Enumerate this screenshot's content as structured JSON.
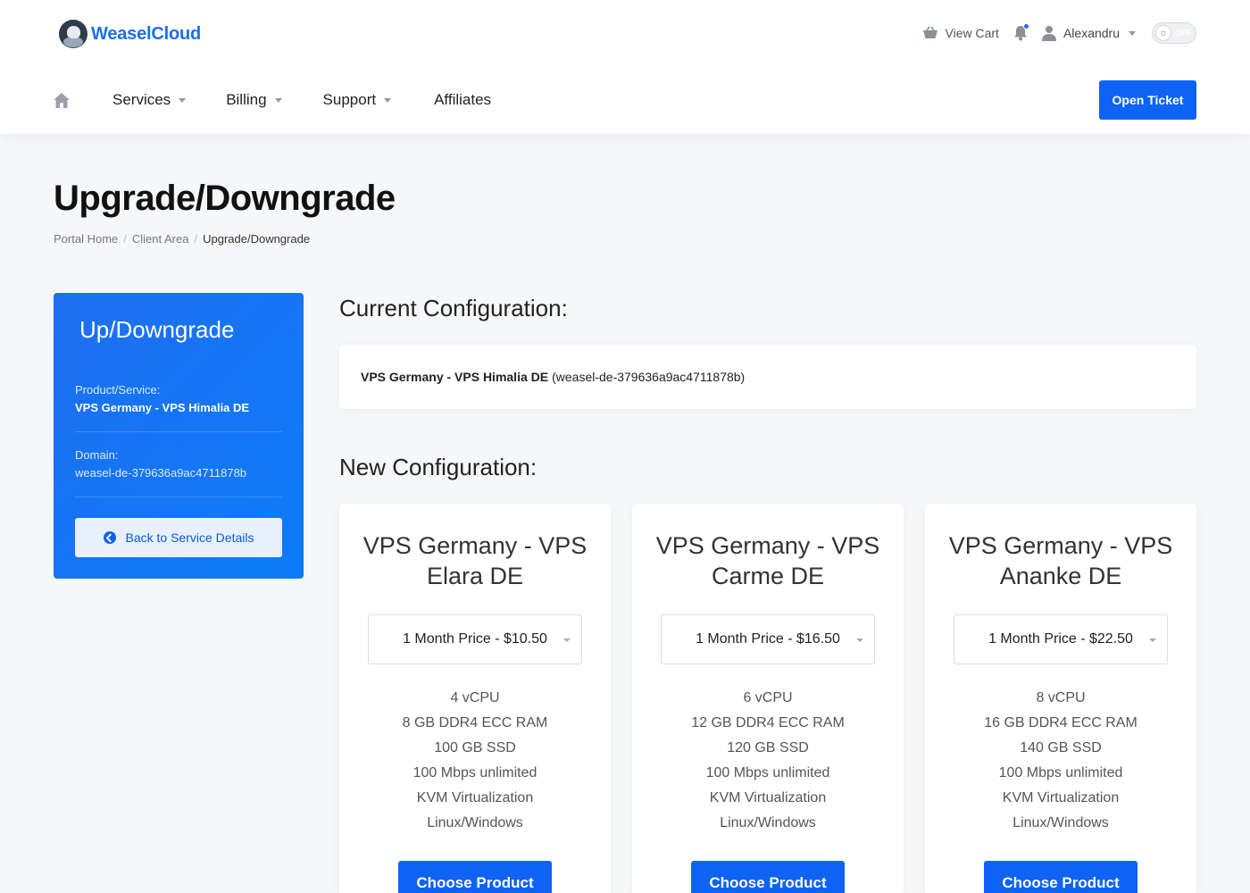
{
  "header": {
    "brand": "WeaselCloud",
    "view_cart": "View Cart",
    "user_name": "Alexandru",
    "theme_toggle": "OFF",
    "open_ticket": "Open Ticket"
  },
  "nav": {
    "items": [
      {
        "label": "Services",
        "has_dropdown": true
      },
      {
        "label": "Billing",
        "has_dropdown": true
      },
      {
        "label": "Support",
        "has_dropdown": true
      },
      {
        "label": "Affiliates",
        "has_dropdown": false
      }
    ]
  },
  "page": {
    "title": "Upgrade/Downgrade",
    "breadcrumb": [
      "Portal Home",
      "Client Area",
      "Upgrade/Downgrade"
    ]
  },
  "sidebar": {
    "title": "Up/Downgrade",
    "product_label": "Product/Service:",
    "product_value": "VPS Germany - VPS Himalia DE",
    "domain_label": "Domain:",
    "domain_value": "weasel-de-379636a9ac4711878b",
    "back_button": "Back to Service Details"
  },
  "current": {
    "heading": "Current Configuration:",
    "product": "VPS Germany - VPS Himalia DE",
    "domain": "(weasel-de-379636a9ac4711878b)"
  },
  "new_config": {
    "heading": "New Configuration:",
    "plans": [
      {
        "name_line1": "VPS Germany - VPS",
        "name_line2": "Elara DE",
        "price": "1 Month Price - $10.50",
        "features": [
          "4 vCPU",
          "8 GB DDR4 ECC RAM",
          "100 GB SSD",
          "100 Mbps unlimited",
          "KVM Virtualization",
          "Linux/Windows"
        ],
        "button": "Choose Product"
      },
      {
        "name_line1": "VPS Germany - VPS",
        "name_line2": "Carme DE",
        "price": "1 Month Price - $16.50",
        "features": [
          "6 vCPU",
          "12 GB DDR4 ECC RAM",
          "120 GB SSD",
          "100 Mbps unlimited",
          "KVM Virtualization",
          "Linux/Windows"
        ],
        "button": "Choose Product"
      },
      {
        "name_line1": "VPS Germany - VPS",
        "name_line2": "Ananke DE",
        "price": "1 Month Price - $22.50",
        "features": [
          "8 vCPU",
          "16 GB DDR4 ECC RAM",
          "140 GB SSD",
          "100 Mbps unlimited",
          "KVM Virtualization",
          "Linux/Windows"
        ],
        "button": "Choose Product"
      }
    ]
  },
  "colors": {
    "accent": "#0e63f4",
    "brand": "#1e6ef0",
    "page_bg": "#f6f7f9"
  }
}
